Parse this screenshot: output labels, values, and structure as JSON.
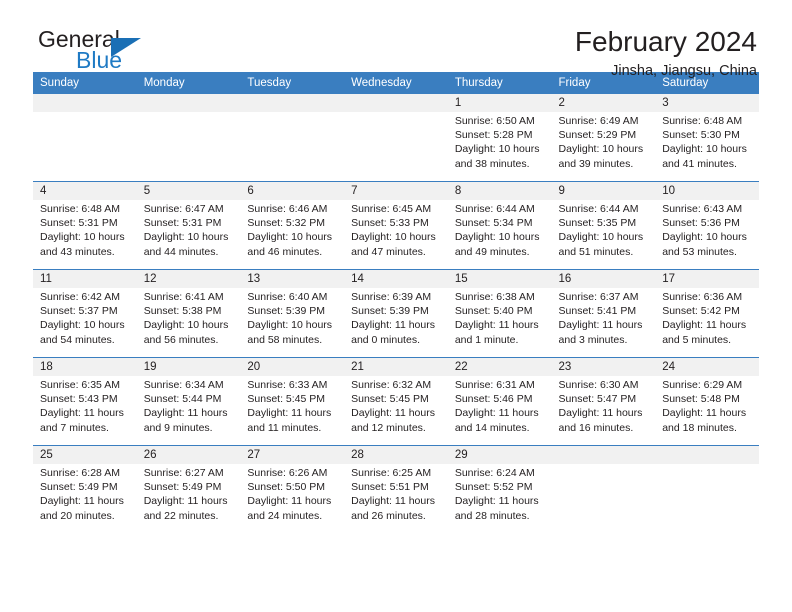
{
  "logo": {
    "word1": "General",
    "word2": "Blue",
    "triangle_color": "#1a6fb5",
    "blue_text_color": "#1f7ac4"
  },
  "header": {
    "title": "February 2024",
    "subtitle": "Jinsha, Jiangsu, China",
    "accent_color": "#3a7ec0"
  },
  "calendar": {
    "weekdays": [
      "Sunday",
      "Monday",
      "Tuesday",
      "Wednesday",
      "Thursday",
      "Friday",
      "Saturday"
    ],
    "weeks": [
      [
        {
          "day": "",
          "lines": []
        },
        {
          "day": "",
          "lines": []
        },
        {
          "day": "",
          "lines": []
        },
        {
          "day": "",
          "lines": []
        },
        {
          "day": "1",
          "lines": [
            "Sunrise: 6:50 AM",
            "Sunset: 5:28 PM",
            "Daylight: 10 hours",
            "and 38 minutes."
          ]
        },
        {
          "day": "2",
          "lines": [
            "Sunrise: 6:49 AM",
            "Sunset: 5:29 PM",
            "Daylight: 10 hours",
            "and 39 minutes."
          ]
        },
        {
          "day": "3",
          "lines": [
            "Sunrise: 6:48 AM",
            "Sunset: 5:30 PM",
            "Daylight: 10 hours",
            "and 41 minutes."
          ]
        }
      ],
      [
        {
          "day": "4",
          "lines": [
            "Sunrise: 6:48 AM",
            "Sunset: 5:31 PM",
            "Daylight: 10 hours",
            "and 43 minutes."
          ]
        },
        {
          "day": "5",
          "lines": [
            "Sunrise: 6:47 AM",
            "Sunset: 5:31 PM",
            "Daylight: 10 hours",
            "and 44 minutes."
          ]
        },
        {
          "day": "6",
          "lines": [
            "Sunrise: 6:46 AM",
            "Sunset: 5:32 PM",
            "Daylight: 10 hours",
            "and 46 minutes."
          ]
        },
        {
          "day": "7",
          "lines": [
            "Sunrise: 6:45 AM",
            "Sunset: 5:33 PM",
            "Daylight: 10 hours",
            "and 47 minutes."
          ]
        },
        {
          "day": "8",
          "lines": [
            "Sunrise: 6:44 AM",
            "Sunset: 5:34 PM",
            "Daylight: 10 hours",
            "and 49 minutes."
          ]
        },
        {
          "day": "9",
          "lines": [
            "Sunrise: 6:44 AM",
            "Sunset: 5:35 PM",
            "Daylight: 10 hours",
            "and 51 minutes."
          ]
        },
        {
          "day": "10",
          "lines": [
            "Sunrise: 6:43 AM",
            "Sunset: 5:36 PM",
            "Daylight: 10 hours",
            "and 53 minutes."
          ]
        }
      ],
      [
        {
          "day": "11",
          "lines": [
            "Sunrise: 6:42 AM",
            "Sunset: 5:37 PM",
            "Daylight: 10 hours",
            "and 54 minutes."
          ]
        },
        {
          "day": "12",
          "lines": [
            "Sunrise: 6:41 AM",
            "Sunset: 5:38 PM",
            "Daylight: 10 hours",
            "and 56 minutes."
          ]
        },
        {
          "day": "13",
          "lines": [
            "Sunrise: 6:40 AM",
            "Sunset: 5:39 PM",
            "Daylight: 10 hours",
            "and 58 minutes."
          ]
        },
        {
          "day": "14",
          "lines": [
            "Sunrise: 6:39 AM",
            "Sunset: 5:39 PM",
            "Daylight: 11 hours",
            "and 0 minutes."
          ]
        },
        {
          "day": "15",
          "lines": [
            "Sunrise: 6:38 AM",
            "Sunset: 5:40 PM",
            "Daylight: 11 hours",
            "and 1 minute."
          ]
        },
        {
          "day": "16",
          "lines": [
            "Sunrise: 6:37 AM",
            "Sunset: 5:41 PM",
            "Daylight: 11 hours",
            "and 3 minutes."
          ]
        },
        {
          "day": "17",
          "lines": [
            "Sunrise: 6:36 AM",
            "Sunset: 5:42 PM",
            "Daylight: 11 hours",
            "and 5 minutes."
          ]
        }
      ],
      [
        {
          "day": "18",
          "lines": [
            "Sunrise: 6:35 AM",
            "Sunset: 5:43 PM",
            "Daylight: 11 hours",
            "and 7 minutes."
          ]
        },
        {
          "day": "19",
          "lines": [
            "Sunrise: 6:34 AM",
            "Sunset: 5:44 PM",
            "Daylight: 11 hours",
            "and 9 minutes."
          ]
        },
        {
          "day": "20",
          "lines": [
            "Sunrise: 6:33 AM",
            "Sunset: 5:45 PM",
            "Daylight: 11 hours",
            "and 11 minutes."
          ]
        },
        {
          "day": "21",
          "lines": [
            "Sunrise: 6:32 AM",
            "Sunset: 5:45 PM",
            "Daylight: 11 hours",
            "and 12 minutes."
          ]
        },
        {
          "day": "22",
          "lines": [
            "Sunrise: 6:31 AM",
            "Sunset: 5:46 PM",
            "Daylight: 11 hours",
            "and 14 minutes."
          ]
        },
        {
          "day": "23",
          "lines": [
            "Sunrise: 6:30 AM",
            "Sunset: 5:47 PM",
            "Daylight: 11 hours",
            "and 16 minutes."
          ]
        },
        {
          "day": "24",
          "lines": [
            "Sunrise: 6:29 AM",
            "Sunset: 5:48 PM",
            "Daylight: 11 hours",
            "and 18 minutes."
          ]
        }
      ],
      [
        {
          "day": "25",
          "lines": [
            "Sunrise: 6:28 AM",
            "Sunset: 5:49 PM",
            "Daylight: 11 hours",
            "and 20 minutes."
          ]
        },
        {
          "day": "26",
          "lines": [
            "Sunrise: 6:27 AM",
            "Sunset: 5:49 PM",
            "Daylight: 11 hours",
            "and 22 minutes."
          ]
        },
        {
          "day": "27",
          "lines": [
            "Sunrise: 6:26 AM",
            "Sunset: 5:50 PM",
            "Daylight: 11 hours",
            "and 24 minutes."
          ]
        },
        {
          "day": "28",
          "lines": [
            "Sunrise: 6:25 AM",
            "Sunset: 5:51 PM",
            "Daylight: 11 hours",
            "and 26 minutes."
          ]
        },
        {
          "day": "29",
          "lines": [
            "Sunrise: 6:24 AM",
            "Sunset: 5:52 PM",
            "Daylight: 11 hours",
            "and 28 minutes."
          ]
        },
        {
          "day": "",
          "lines": []
        },
        {
          "day": "",
          "lines": []
        }
      ]
    ]
  }
}
